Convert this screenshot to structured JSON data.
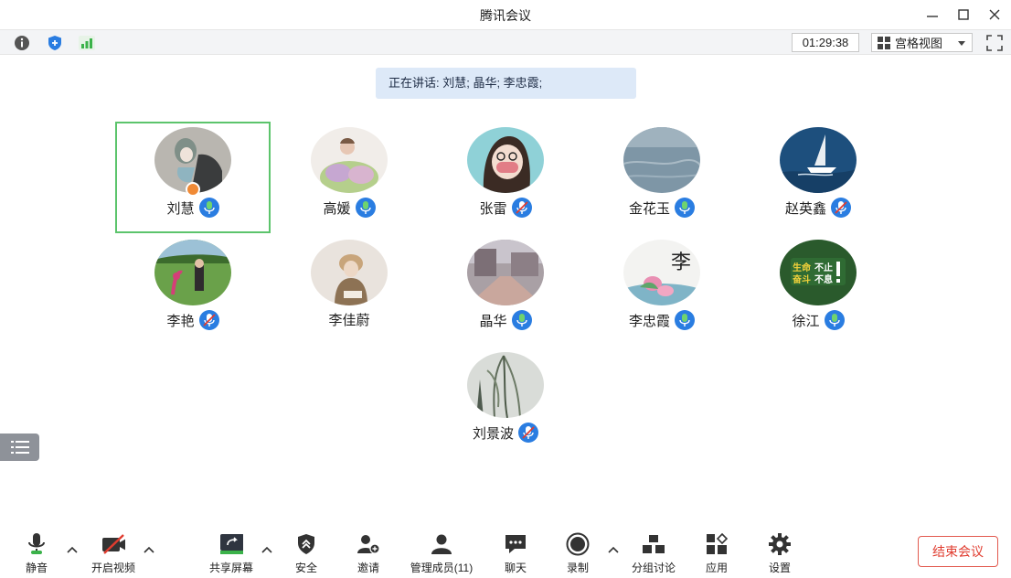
{
  "window": {
    "title": "腾讯会议"
  },
  "infobar": {
    "timer": "01:29:38",
    "view_label": "宫格视图"
  },
  "speaking": {
    "text": "正在讲话: 刘慧; 晶华; 李忠霞;"
  },
  "participants": [
    {
      "name": "刘慧",
      "mic": "on",
      "host": true,
      "active": true
    },
    {
      "name": "高媛",
      "mic": "on"
    },
    {
      "name": "张雷",
      "mic": "muted"
    },
    {
      "name": "金花玉",
      "mic": "on"
    },
    {
      "name": "赵英鑫",
      "mic": "muted"
    },
    {
      "name": "李艳",
      "mic": "muted"
    },
    {
      "name": "李佳蔚",
      "mic": "none"
    },
    {
      "name": "晶华",
      "mic": "on"
    },
    {
      "name": "李忠霞",
      "mic": "on"
    },
    {
      "name": "徐江",
      "mic": "on"
    },
    {
      "name": "刘景波",
      "mic": "muted"
    }
  ],
  "toolbar": {
    "mute": "静音",
    "video": "开启视频",
    "share": "共享屏幕",
    "security": "安全",
    "invite": "邀请",
    "members": "管理成员(11)",
    "chat": "聊天",
    "record": "录制",
    "breakout": "分组讨论",
    "apps": "应用",
    "settings": "设置",
    "end": "结束会议"
  },
  "colors": {
    "accent": "#2a7de1",
    "active_border": "#5cc46c",
    "end": "#e03c2f",
    "speaking_bg": "#dde9f8"
  }
}
